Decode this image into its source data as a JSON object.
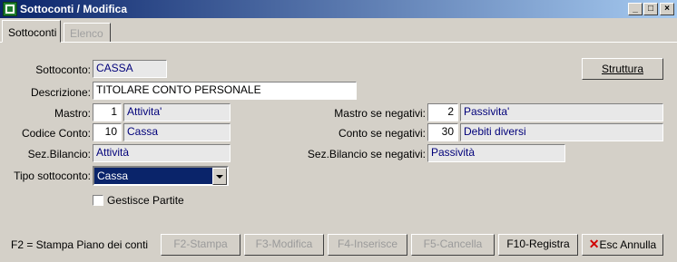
{
  "window": {
    "title": "Sottoconti / Modifica",
    "controls": [
      "_",
      "□",
      "×"
    ]
  },
  "tabs": [
    {
      "label": "Sottoconti",
      "active": true
    },
    {
      "label": "Elenco",
      "active": false
    }
  ],
  "form": {
    "sottoconto_label": "Sottoconto:",
    "sottoconto_value": "CASSA",
    "descrizione_label": "Descrizione:",
    "descrizione_value": "TITOLARE CONTO PERSONALE",
    "mastro_label": "Mastro:",
    "mastro_num": "1",
    "mastro_desc": "Attivita'",
    "codice_conto_label": "Codice Conto:",
    "codice_conto_num": "10",
    "codice_conto_desc": "Cassa",
    "sez_bilancio_label": "Sez.Bilancio:",
    "sez_bilancio_value": "Attività",
    "tipo_sottoconto_label": "Tipo sottoconto:",
    "tipo_sottoconto_value": "Cassa",
    "gestisce_partite_label": "Gestisce Partite",
    "mastro_neg_label": "Mastro se negativi:",
    "mastro_neg_num": "2",
    "mastro_neg_desc": "Passivita'",
    "conto_neg_label": "Conto se negativi:",
    "conto_neg_num": "30",
    "conto_neg_desc": "Debiti diversi",
    "sez_bil_neg_label": "Sez.Bilancio se negativi:",
    "sez_bil_neg_value": "Passività",
    "struttura_button": "Struttura"
  },
  "footer": {
    "hint": "F2 = Stampa Piano dei conti",
    "buttons": {
      "stampa": "F2-Stampa",
      "modifica": "F3-Modifica",
      "inserisce": "F4-Inserisce",
      "cancella": "F5-Cancella",
      "registra": "F10-Registra",
      "annulla_key": "Esc",
      "annulla": "Annulla"
    }
  },
  "colors": {
    "titlebar_start": "#0a246a",
    "titlebar_end": "#a6caf0",
    "window_bg": "#d4d0c8",
    "field_text": "#00007a",
    "cancel_x": "#d00000"
  }
}
